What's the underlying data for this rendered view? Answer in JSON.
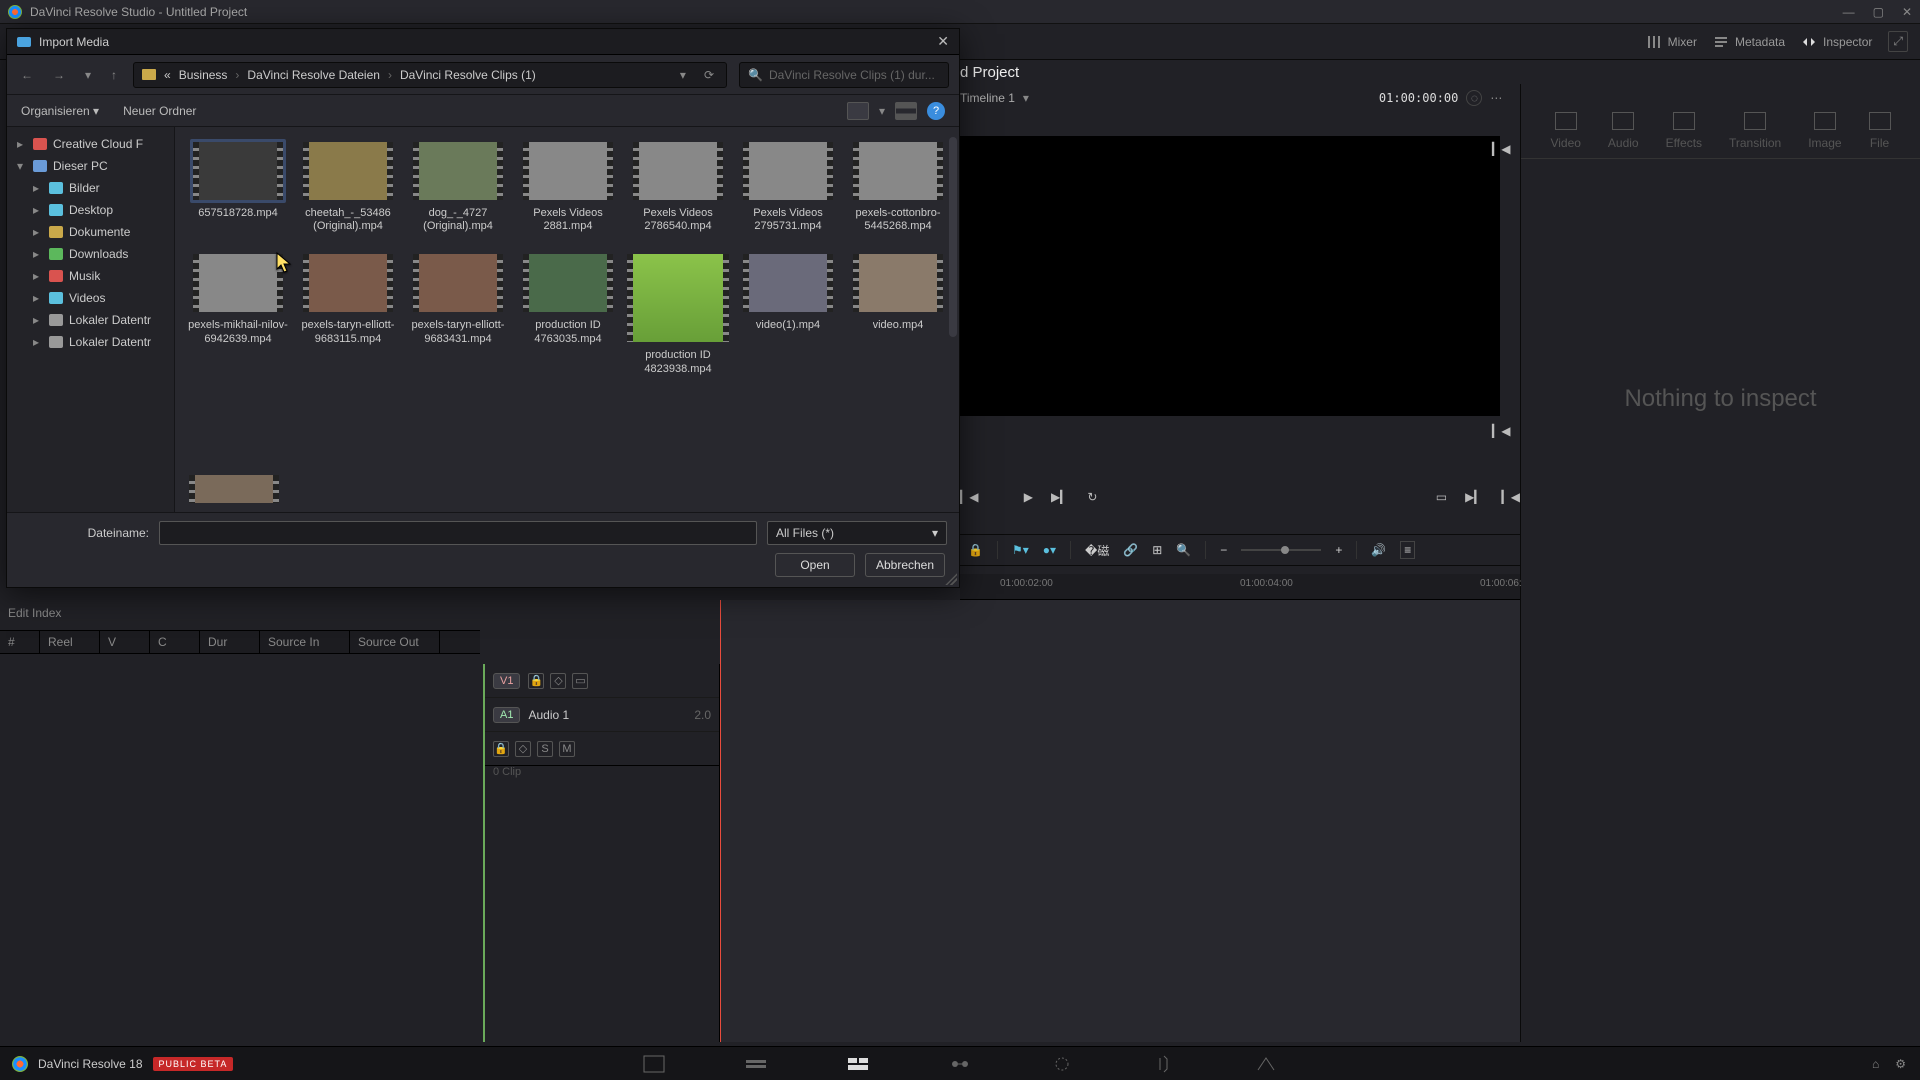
{
  "app": {
    "window_title": "DaVinci Resolve Studio - Untitled Project",
    "product_name": "DaVinci Resolve 18",
    "beta_label": "PUBLIC BETA"
  },
  "header": {
    "mixer": "Mixer",
    "metadata": "Metadata",
    "inspector": "Inspector"
  },
  "project": {
    "title": "d Project",
    "timeline_name": "Timeline 1",
    "timecode": "01:00:00:00"
  },
  "inspector_tabs": {
    "video": "Video",
    "audio": "Audio",
    "effects": "Effects",
    "transition": "Transition",
    "image": "Image",
    "file": "File"
  },
  "inspector_body": "Nothing to inspect",
  "timeline_ruler": {
    "t1": "01:00:02:00",
    "t2": "01:00:04:00",
    "t3": "01:00:06:"
  },
  "edit_index": {
    "title": "Edit Index",
    "cols": {
      "num": "#",
      "reel": "Reel",
      "v": "V",
      "c": "C",
      "dur": "Dur",
      "sin": "Source In",
      "sout": "Source Out"
    }
  },
  "tracks": {
    "v1": "V1",
    "a1": "A1",
    "audio1": "Audio 1",
    "ch": "2.0",
    "solo": "S",
    "mute": "M",
    "clipcount": "0 Clip"
  },
  "dialog": {
    "title": "Import Media",
    "nav": {
      "crumb0": "«",
      "crumb1": "Business",
      "crumb2": "DaVinci Resolve Dateien",
      "crumb3": "DaVinci Resolve Clips (1)",
      "search_placeholder": "DaVinci Resolve Clips (1) dur..."
    },
    "organize": "Organisieren",
    "new_folder": "Neuer Ordner",
    "tree": {
      "creative_cloud": "Creative Cloud F",
      "this_pc": "Dieser PC",
      "pictures": "Bilder",
      "desktop": "Desktop",
      "documents": "Dokumente",
      "downloads": "Downloads",
      "music": "Musik",
      "videos": "Videos",
      "disk1": "Lokaler Datentr",
      "disk2": "Lokaler Datentr"
    },
    "files": [
      "657518728.mp4",
      "cheetah_-_53486 (Original).mp4",
      "dog_-_4727 (Original).mp4",
      "Pexels Videos 2881.mp4",
      "Pexels Videos 2786540.mp4",
      "Pexels Videos 2795731.mp4",
      "pexels-cottonbro-5445268.mp4",
      "pexels-mikhail-nilov-6942639.mp4",
      "pexels-taryn-elliott-9683115.mp4",
      "pexels-taryn-elliott-9683431.mp4",
      "production ID 4763035.mp4",
      "production ID 4823938.mp4",
      "video(1).mp4",
      "video.mp4"
    ],
    "filename_label": "Dateiname:",
    "filter": "All Files (*)",
    "open": "Open",
    "cancel": "Abbrechen"
  }
}
